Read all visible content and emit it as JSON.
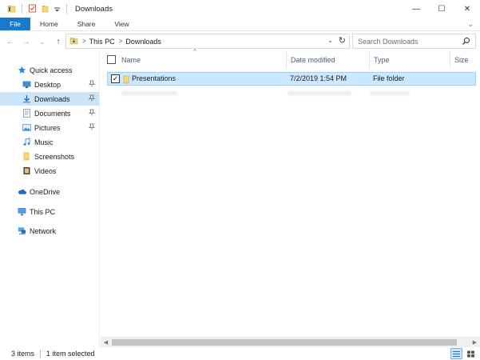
{
  "window": {
    "title": "Downloads",
    "minimize_glyph": "—",
    "maximize_glyph": "☐",
    "close_glyph": "✕"
  },
  "ribbon": {
    "tabs": [
      {
        "label": "File"
      },
      {
        "label": "Home"
      },
      {
        "label": "Share"
      },
      {
        "label": "View"
      }
    ],
    "expand_glyph": "⌄"
  },
  "nav": {
    "back_glyph": "←",
    "forward_glyph": "→",
    "recent_glyph": "⌄",
    "up_glyph": "↑"
  },
  "address": {
    "crumbs": [
      "This PC",
      "Downloads"
    ],
    "separator": ">",
    "dropdown_glyph": "⌄",
    "refresh_glyph": "↻"
  },
  "search": {
    "placeholder": "Search Downloads"
  },
  "sidebar": {
    "items": [
      {
        "label": "Quick access",
        "icon": "star-icon",
        "pinned": false
      },
      {
        "label": "Desktop",
        "icon": "desktop-folder-icon",
        "pinned": true
      },
      {
        "label": "Downloads",
        "icon": "downloads-folder-icon",
        "pinned": true,
        "selected": true
      },
      {
        "label": "Documents",
        "icon": "documents-folder-icon",
        "pinned": true
      },
      {
        "label": "Pictures",
        "icon": "pictures-folder-icon",
        "pinned": true
      },
      {
        "label": "Music",
        "icon": "music-folder-icon",
        "pinned": false
      },
      {
        "label": "Screenshots",
        "icon": "folder-icon",
        "pinned": false
      },
      {
        "label": "Videos",
        "icon": "videos-folder-icon",
        "pinned": false
      },
      {
        "label": "OneDrive",
        "icon": "cloud-icon",
        "pinned": false
      },
      {
        "label": "This PC",
        "icon": "computer-icon",
        "pinned": false
      },
      {
        "label": "Network",
        "icon": "network-icon",
        "pinned": false
      }
    ],
    "pin_glyph": "📌"
  },
  "columns": [
    {
      "label": "Name"
    },
    {
      "label": "Date modified"
    },
    {
      "label": "Type"
    },
    {
      "label": "Size"
    }
  ],
  "sort_glyph": "^",
  "files": [
    {
      "name": "Presentations",
      "date_modified": "7/2/2019 1:54 PM",
      "type": "File folder",
      "size": "",
      "selected": true,
      "checked": true
    }
  ],
  "status": {
    "item_count": "3 items",
    "selection": "1 item selected"
  },
  "colors": {
    "accent": "#1979ca",
    "selection": "#cce8ff",
    "folder": "#f8d775"
  }
}
